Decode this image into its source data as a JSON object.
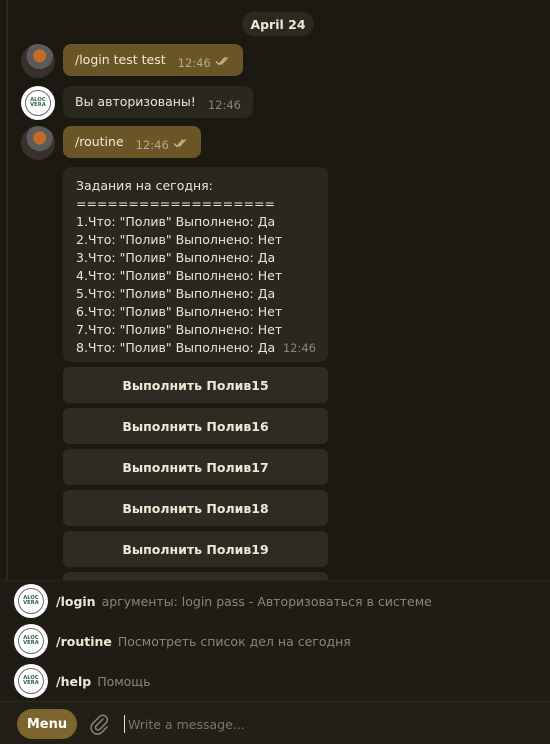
{
  "chat": {
    "date": "April 24",
    "messages": [
      {
        "text": "/login test test",
        "time": "12:46"
      },
      {
        "text": "Вы авторизованы!",
        "time": "12:46"
      },
      {
        "text": "/routine",
        "time": "12:46"
      }
    ],
    "tasks": {
      "title": "Задания на сегодня:",
      "separator": "===================",
      "lines": [
        "1.Что: \"Полив\"  Выполнено: Да",
        "2.Что: \"Полив\"  Выполнено: Нет",
        "3.Что: \"Полив\"  Выполнено: Да",
        "4.Что: \"Полив\"  Выполнено: Нет",
        "5.Что: \"Полив\"  Выполнено: Да",
        "6.Что: \"Полив\"  Выполнено: Нет",
        "7.Что: \"Полив\"  Выполнено: Нет",
        "8.Что: \"Полив\"  Выполнено: Да"
      ],
      "time": "12:46"
    },
    "keyboard": [
      "Выполнить Полив15",
      "Выполнить Полив16",
      "Выполнить Полив17",
      "Выполнить Полив18",
      "Выполнить Полив19"
    ]
  },
  "bot_logo_text": "ALOC\nVERA",
  "commands": [
    {
      "name": "/login",
      "desc": "аргументы: login pass - Авторизоваться в системе"
    },
    {
      "name": "/routine",
      "desc": "Посмотреть список дел на сегодня"
    },
    {
      "name": "/help",
      "desc": "Помощь"
    }
  ],
  "composer": {
    "menu_label": "Menu",
    "placeholder": "Write a message..."
  },
  "colors": {
    "outgoing_bubble": "#6a5526",
    "incoming_bubble": "#2a271f",
    "accent": "#7d6530"
  },
  "icons": {
    "read_ticks": "double-check-icon",
    "attach": "paperclip-icon"
  }
}
